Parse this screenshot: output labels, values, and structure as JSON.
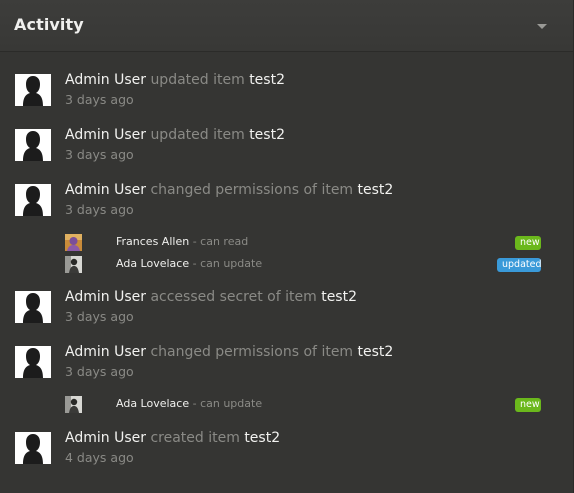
{
  "header": {
    "title": "Activity",
    "toggle_icon": "chevron-down-icon"
  },
  "colors": {
    "badge_new": "#6bb81c",
    "badge_updated": "#3a9ad9"
  },
  "entries": [
    {
      "actor": "Admin User",
      "verb": "updated item",
      "target": "test2",
      "time": "3 days ago",
      "subitems": []
    },
    {
      "actor": "Admin User",
      "verb": "updated item",
      "target": "test2",
      "time": "3 days ago",
      "subitems": []
    },
    {
      "actor": "Admin User",
      "verb": "changed permissions of item",
      "target": "test2",
      "time": "3 days ago",
      "subitems": [
        {
          "name": "Frances Allen",
          "permission": "- can read",
          "badge": "new"
        },
        {
          "name": "Ada Lovelace",
          "permission": "- can update",
          "badge": "updated"
        }
      ]
    },
    {
      "actor": "Admin User",
      "verb": "accessed secret of item",
      "target": "test2",
      "time": "3 days ago",
      "subitems": []
    },
    {
      "actor": "Admin User",
      "verb": "changed permissions of item",
      "target": "test2",
      "time": "3 days ago",
      "subitems": [
        {
          "name": "Ada Lovelace",
          "permission": "- can update",
          "badge": "new"
        }
      ]
    },
    {
      "actor": "Admin User",
      "verb": "created item",
      "target": "test2",
      "time": "4 days ago",
      "subitems": []
    }
  ]
}
